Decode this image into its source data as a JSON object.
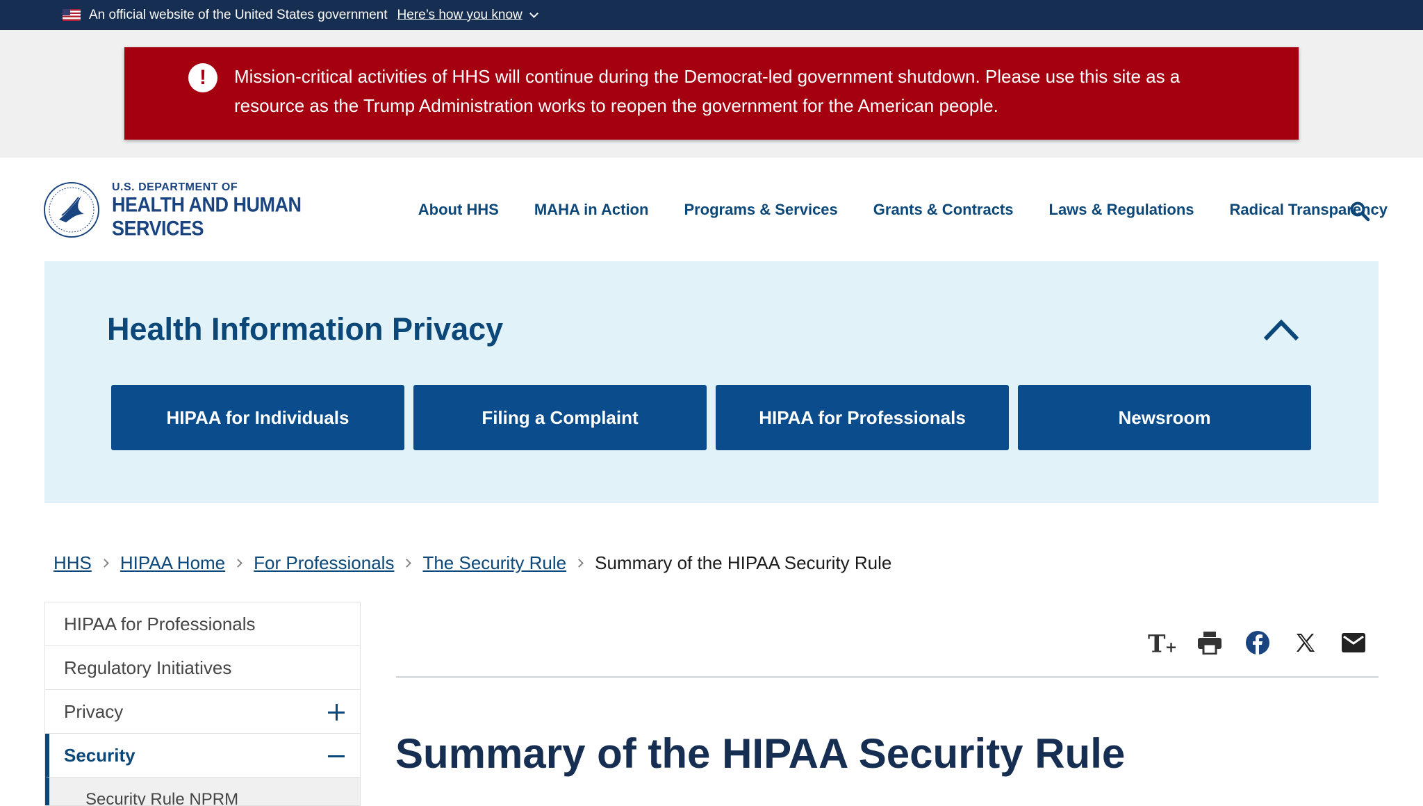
{
  "gov_banner": {
    "text": "An official website of the United States government",
    "link": "Here’s how you know"
  },
  "alert": {
    "text": "Mission-critical activities of HHS will continue during the Democrat-led government shutdown. Please use this site as a resource as the Trump Administration works to reopen the government for the American people."
  },
  "header": {
    "logo_small": "U.S. DEPARTMENT OF",
    "logo_big": "HEALTH AND HUMAN SERVICES",
    "nav": [
      "About HHS",
      "MAHA in Action",
      "Programs & Services",
      "Grants & Contracts",
      "Laws & Regulations",
      "Radical Transparency"
    ]
  },
  "privacy": {
    "title": "Health Information Privacy",
    "tiles": [
      "HIPAA for Individuals",
      "Filing a Complaint",
      "HIPAA for Professionals",
      "Newsroom"
    ]
  },
  "breadcrumb": {
    "items": [
      "HHS",
      "HIPAA Home",
      "For Professionals",
      "The Security Rule"
    ],
    "current": "Summary of the HIPAA Security Rule"
  },
  "sidenav": {
    "items": [
      "HIPAA for Professionals",
      "Regulatory Initiatives",
      "Privacy",
      "Security"
    ],
    "sub_item": "Security Rule NPRM"
  },
  "tools": [
    "text-size-icon",
    "print-icon",
    "facebook-icon",
    "x-icon",
    "email-icon"
  ],
  "page": {
    "title": "Summary of the HIPAA Security Rule"
  },
  "colors": {
    "banner": "#162e51",
    "alert": "#a50010",
    "primary": "#0b4778",
    "tile": "#0b4c8c",
    "privacy_bg": "#e1f3f8"
  }
}
